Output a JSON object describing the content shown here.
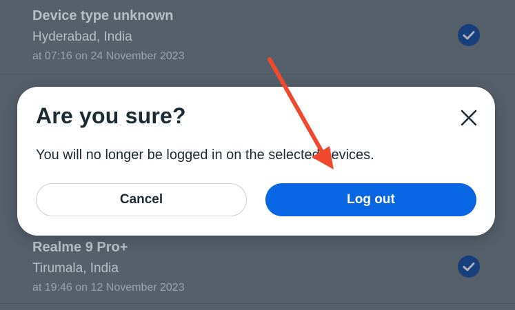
{
  "devices": [
    {
      "name": "Device type unknown",
      "location": "Hyderabad, India",
      "time": "at 07:16 on 24 November 2023"
    },
    {
      "name": "Realme 9 Pro+",
      "location": "Tirumala, India",
      "time": "at 19:46 on 12 November 2023"
    }
  ],
  "dialog": {
    "title": "Are you sure?",
    "message": "You will no longer be logged in on the selected devices.",
    "cancel_label": "Cancel",
    "logout_label": "Log out"
  },
  "colors": {
    "overlay": "#56606b",
    "primary": "#0866e3",
    "annotation_arrow": "#f1492e"
  },
  "icons": {
    "close": "close-icon",
    "check": "check-circle-icon"
  }
}
